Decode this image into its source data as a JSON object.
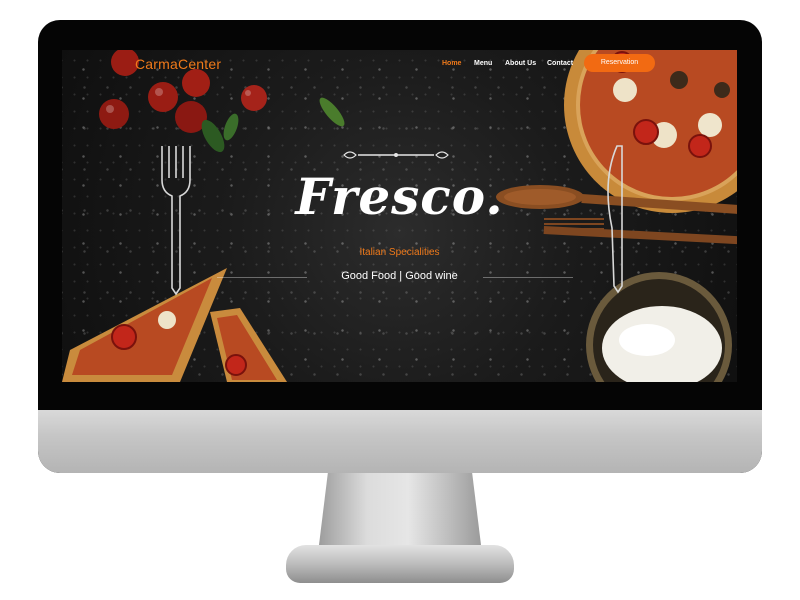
{
  "nav": {
    "brand": "CarmaCenter",
    "links": [
      {
        "label": "Home",
        "active": true
      },
      {
        "label": "Menu",
        "active": false
      },
      {
        "label": "About Us",
        "active": false
      },
      {
        "label": "Contact",
        "active": false
      }
    ],
    "cta_label": "Reservation"
  },
  "hero": {
    "title": "Fresco.",
    "subtitle": "Italian Specialities",
    "tagline": "Good Food | Good wine"
  },
  "colors": {
    "accent": "#f26a12",
    "brand_text": "#f07a1a",
    "background": "#1b1b1b",
    "text": "#ffffff"
  },
  "icons": [
    "fork-icon",
    "knife-icon",
    "ornament-divider"
  ]
}
